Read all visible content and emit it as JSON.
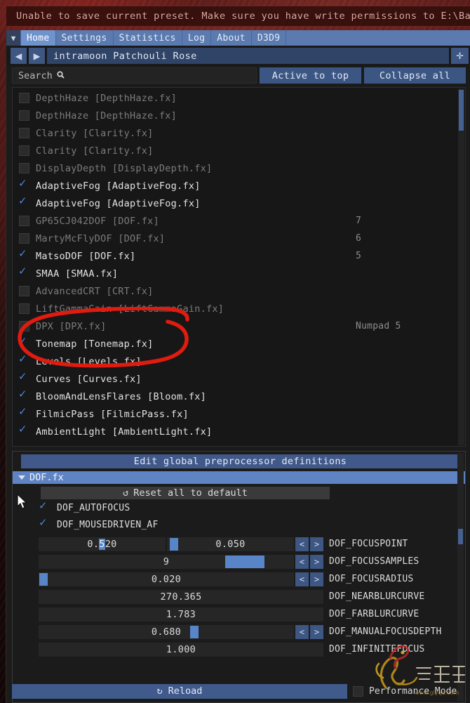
{
  "notification": {
    "text": "Unable to save current preset. Make sure you have write permissions to E:\\BaiduNet"
  },
  "tabs": {
    "collapse_icon": "▼",
    "items": [
      {
        "label": "Home",
        "active": true
      },
      {
        "label": "Settings",
        "active": false
      },
      {
        "label": "Statistics",
        "active": false
      },
      {
        "label": "Log",
        "active": false
      },
      {
        "label": "About",
        "active": false
      },
      {
        "label": "D3D9",
        "active": false
      }
    ]
  },
  "preset": {
    "prev_icon": "◀",
    "next_icon": "▶",
    "value": "intramoon Patchouli Rose",
    "add_icon": "✛"
  },
  "search": {
    "placeholder": "Search",
    "value": "",
    "icon": "search-icon",
    "icon_glyph": "🔍"
  },
  "toolbar": {
    "active_to_top": "Active to top",
    "collapse_all": "Collapse all"
  },
  "effects": [
    {
      "name": "DepthHaze [DepthHaze.fx]",
      "enabled": false,
      "key": ""
    },
    {
      "name": "DepthHaze [DepthHaze.fx]",
      "enabled": false,
      "key": ""
    },
    {
      "name": "Clarity [Clarity.fx]",
      "enabled": false,
      "key": ""
    },
    {
      "name": "Clarity [Clarity.fx]",
      "enabled": false,
      "key": ""
    },
    {
      "name": "DisplayDepth [DisplayDepth.fx]",
      "enabled": false,
      "key": ""
    },
    {
      "name": "AdaptiveFog [AdaptiveFog.fx]",
      "enabled": true,
      "key": ""
    },
    {
      "name": "AdaptiveFog [AdaptiveFog.fx]",
      "enabled": true,
      "key": ""
    },
    {
      "name": "GP65CJ042DOF [DOF.fx]",
      "enabled": false,
      "key": "7"
    },
    {
      "name": "MartyMcFlyDOF [DOF.fx]",
      "enabled": false,
      "key": "6"
    },
    {
      "name": "MatsoDOF [DOF.fx]",
      "enabled": true,
      "key": "5"
    },
    {
      "name": "SMAA [SMAA.fx]",
      "enabled": true,
      "key": ""
    },
    {
      "name": "AdvancedCRT [CRT.fx]",
      "enabled": false,
      "key": ""
    },
    {
      "name": "LiftGammaGain [LiftGammaGain.fx]",
      "enabled": false,
      "key": ""
    },
    {
      "name": "DPX [DPX.fx]",
      "enabled": false,
      "key": "Numpad 5"
    },
    {
      "name": "Tonemap [Tonemap.fx]",
      "enabled": true,
      "key": ""
    },
    {
      "name": "Levels [Levels.fx]",
      "enabled": true,
      "key": ""
    },
    {
      "name": "Curves [Curves.fx]",
      "enabled": true,
      "key": ""
    },
    {
      "name": "BloomAndLensFlares [Bloom.fx]",
      "enabled": true,
      "key": ""
    },
    {
      "name": "FilmicPass [FilmicPass.fx]",
      "enabled": true,
      "key": ""
    },
    {
      "name": "AmbientLight [AmbientLight.fx]",
      "enabled": true,
      "key": ""
    }
  ],
  "preprocessor": {
    "header": "Edit global preprocessor definitions",
    "file": "DOF.fx",
    "reset_label": "Reset all to default",
    "reset_icon": "↺",
    "checkboxes": [
      {
        "label": "DOF_AUTOFOCUS",
        "checked": true
      },
      {
        "label": "DOF_MOUSEDRIVEN_AF",
        "checked": true
      }
    ],
    "rows": [
      {
        "name": "DOF_FOCUSPOINT",
        "value": "0.520",
        "second_value": "0.050",
        "has_stepper": true,
        "two_slots": true
      },
      {
        "name": "DOF_FOCUSSAMPLES",
        "value": "9",
        "has_stepper": true,
        "two_slots": false
      },
      {
        "name": "DOF_FOCUSRADIUS",
        "value": "0.020",
        "has_stepper": true,
        "two_slots": false
      },
      {
        "name": "DOF_NEARBLURCURVE",
        "value": "270.365",
        "has_stepper": false,
        "two_slots": false
      },
      {
        "name": "DOF_FARBLURCURVE",
        "value": "1.783",
        "has_stepper": false,
        "two_slots": false
      },
      {
        "name": "DOF_MANUALFOCUSDEPTH",
        "value": "0.680",
        "has_stepper": true,
        "two_slots": false
      },
      {
        "name": "DOF_INFINITEFOCUS",
        "value": "1.000",
        "has_stepper": false,
        "two_slots": false
      }
    ],
    "stepper_prev": "<",
    "stepper_next": ">"
  },
  "footer": {
    "reload_label": "Reload",
    "reload_icon": "↻",
    "performance_mode_label": "Performance Mode",
    "performance_mode_checked": false
  },
  "annotation": {
    "color": "#e01b10",
    "note": "hand-drawn red circle around the three DOF effect entries"
  },
  "colors": {
    "accent_blue": "#4f86d6",
    "button_blue": "#3c5684",
    "tab_active": "#6e93cd",
    "panel_bg": "#1b1b1b",
    "list_bg": "#171717",
    "error_text": "#e4a8a1"
  }
}
